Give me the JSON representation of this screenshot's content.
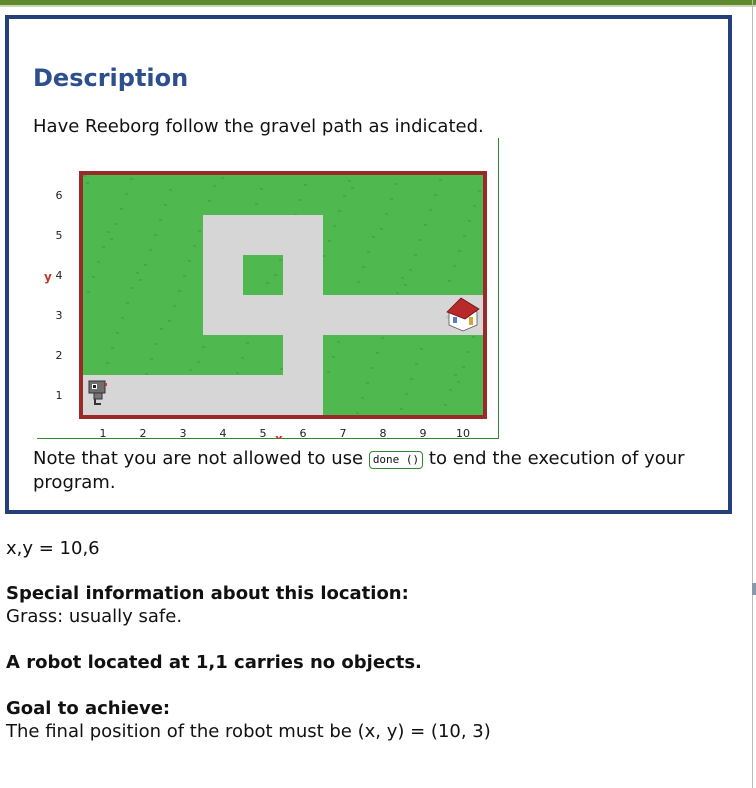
{
  "description": {
    "title": "Description",
    "intro": "Have Reeborg follow the gravel path as indicated.",
    "note_before": "Note that you are not allowed to use",
    "code": "done ()",
    "note_after": "to end the execution of your program."
  },
  "world": {
    "x_axis_label": "x",
    "y_axis_label": "y",
    "x_ticks": [
      "1",
      "2",
      "3",
      "4",
      "5",
      "6",
      "7",
      "8",
      "9",
      "10"
    ],
    "y_ticks": [
      "1",
      "2",
      "3",
      "4",
      "5",
      "6"
    ],
    "columns": 10,
    "rows": 6,
    "gravel_tiles": [
      [
        1,
        1
      ],
      [
        2,
        1
      ],
      [
        3,
        1
      ],
      [
        4,
        1
      ],
      [
        5,
        1
      ],
      [
        6,
        1
      ],
      [
        6,
        2
      ],
      [
        6,
        3
      ],
      [
        7,
        3
      ],
      [
        8,
        3
      ],
      [
        9,
        3
      ],
      [
        10,
        3
      ],
      [
        4,
        3
      ],
      [
        5,
        3
      ],
      [
        4,
        4
      ],
      [
        6,
        4
      ],
      [
        4,
        5
      ],
      [
        5,
        5
      ],
      [
        6,
        5
      ]
    ],
    "robot_position": [
      1,
      1
    ],
    "home_position": [
      10,
      3
    ],
    "colors": {
      "grass": "#4fb84f",
      "gravel": "#d6d6d6",
      "wall": "#9a2a2a",
      "axis_label": "#c0392b",
      "frame": "#2f8a2f"
    }
  },
  "info": {
    "coords": "x,y = 10,6",
    "special_heading": "Special information about this location:",
    "special_text": "Grass: usually safe.",
    "robot_text": "A robot located at 1,1 carries no objects.",
    "goal_heading": "Goal to achieve:",
    "goal_text": "The final position of the robot must be (x, y) = (10, 3)"
  }
}
